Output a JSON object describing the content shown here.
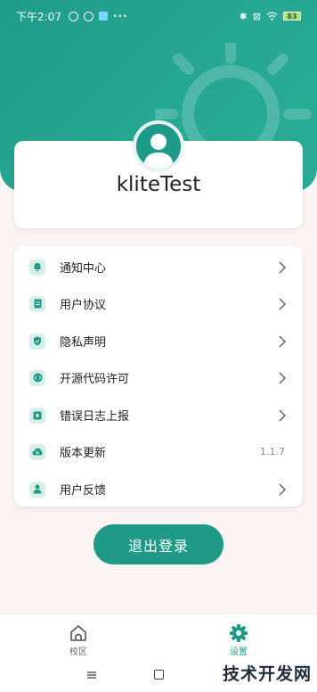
{
  "status_bar": {
    "time": "下午2:07",
    "dots": "···",
    "battery": "83"
  },
  "profile": {
    "username": "kliteTest"
  },
  "menu": [
    {
      "label": "通知中心",
      "icon": "bell-icon",
      "trailing": "chevron"
    },
    {
      "label": "用户协议",
      "icon": "document-icon",
      "trailing": "chevron"
    },
    {
      "label": "隐私声明",
      "icon": "shield-check-icon",
      "trailing": "chevron"
    },
    {
      "label": "开源代码许可",
      "icon": "code-icon",
      "trailing": "chevron"
    },
    {
      "label": "错误日志上报",
      "icon": "log-icon",
      "trailing": "chevron"
    },
    {
      "label": "版本更新",
      "icon": "cloud-download-icon",
      "trailing": "text",
      "version": "1.1.7"
    },
    {
      "label": "用户反馈",
      "icon": "user-feedback-icon",
      "trailing": "chevron"
    }
  ],
  "logout": {
    "label": "退出登录"
  },
  "tabs": [
    {
      "label": "校区",
      "icon": "home-icon",
      "active": false
    },
    {
      "label": "设置",
      "icon": "gear-icon",
      "active": true
    }
  ],
  "watermark": "技术开发网",
  "colors": {
    "primary": "#1f9a87",
    "icon_bg": "#d6efe9",
    "page_bg": "#fbf4f2"
  }
}
